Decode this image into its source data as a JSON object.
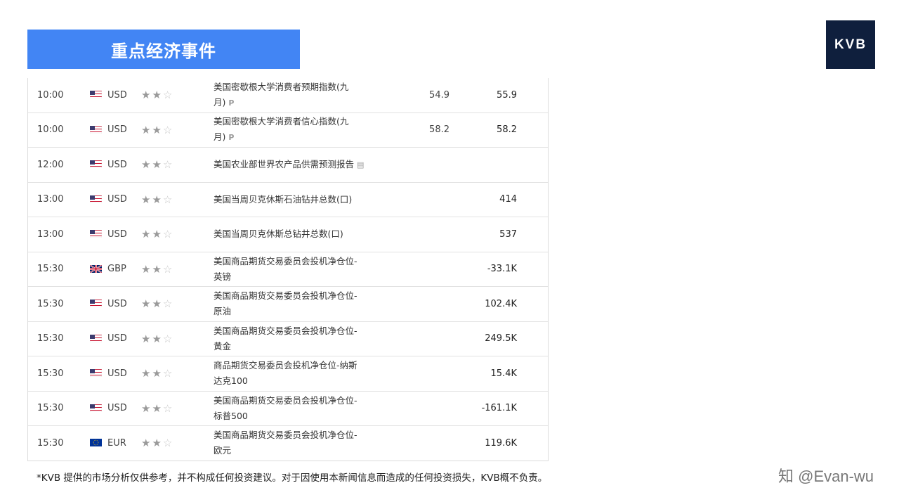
{
  "banner": {
    "title": "重点经济事件"
  },
  "logo": {
    "text": "KVB"
  },
  "icons": {
    "star_on": "★",
    "star_off": "☆",
    "prelim": "P",
    "report": "▤"
  },
  "colors": {
    "banner": "#4285f4",
    "logo_bg": "#0f1f3d"
  },
  "rows": [
    {
      "time": "10:00",
      "flag": "us",
      "ccy": "USD",
      "stars": 2,
      "event": "美国密歇根大学消费者预期指数(九月)",
      "icon": "prelim",
      "prev": "54.9",
      "actual": "55.9"
    },
    {
      "time": "10:00",
      "flag": "us",
      "ccy": "USD",
      "stars": 2,
      "event": "美国密歇根大学消费者信心指数(九月)",
      "icon": "prelim",
      "prev": "58.2",
      "actual": "58.2"
    },
    {
      "time": "12:00",
      "flag": "us",
      "ccy": "USD",
      "stars": 2,
      "event": "美国农业部世界农产品供需预测报告",
      "icon": "report",
      "prev": "",
      "actual": ""
    },
    {
      "time": "13:00",
      "flag": "us",
      "ccy": "USD",
      "stars": 2,
      "event": "美国当周贝克休斯石油钻井总数(口)",
      "icon": "",
      "prev": "",
      "actual": "414"
    },
    {
      "time": "13:00",
      "flag": "us",
      "ccy": "USD",
      "stars": 2,
      "event": "美国当周贝克休斯总钻井总数(口)",
      "icon": "",
      "prev": "",
      "actual": "537"
    },
    {
      "time": "15:30",
      "flag": "gb",
      "ccy": "GBP",
      "stars": 2,
      "event": "美国商品期货交易委员会投机净仓位-英镑",
      "icon": "",
      "prev": "",
      "actual": "-33.1K"
    },
    {
      "time": "15:30",
      "flag": "us",
      "ccy": "USD",
      "stars": 2,
      "event": "美国商品期货交易委员会投机净仓位-原油",
      "icon": "",
      "prev": "",
      "actual": "102.4K"
    },
    {
      "time": "15:30",
      "flag": "us",
      "ccy": "USD",
      "stars": 2,
      "event": "美国商品期货交易委员会投机净仓位-黄金",
      "icon": "",
      "prev": "",
      "actual": "249.5K"
    },
    {
      "time": "15:30",
      "flag": "us",
      "ccy": "USD",
      "stars": 2,
      "event": "商品期货交易委员会投机净仓位-纳斯达克100",
      "icon": "",
      "prev": "",
      "actual": "15.4K"
    },
    {
      "time": "15:30",
      "flag": "us",
      "ccy": "USD",
      "stars": 2,
      "event": "美国商品期货交易委员会投机净仓位-标普500",
      "icon": "",
      "prev": "",
      "actual": "-161.1K"
    },
    {
      "time": "15:30",
      "flag": "eu",
      "ccy": "EUR",
      "stars": 2,
      "event": "美国商品期货交易委员会投机净仓位-欧元",
      "icon": "",
      "prev": "",
      "actual": "119.6K"
    }
  ],
  "disclaimer": "*KVB 提供的市场分析仅供参考，并不构成任何投资建议。对于因使用本新闻信息而造成的任何投资损失，KVB概不负责。",
  "watermark": "知 @Evan-wu"
}
